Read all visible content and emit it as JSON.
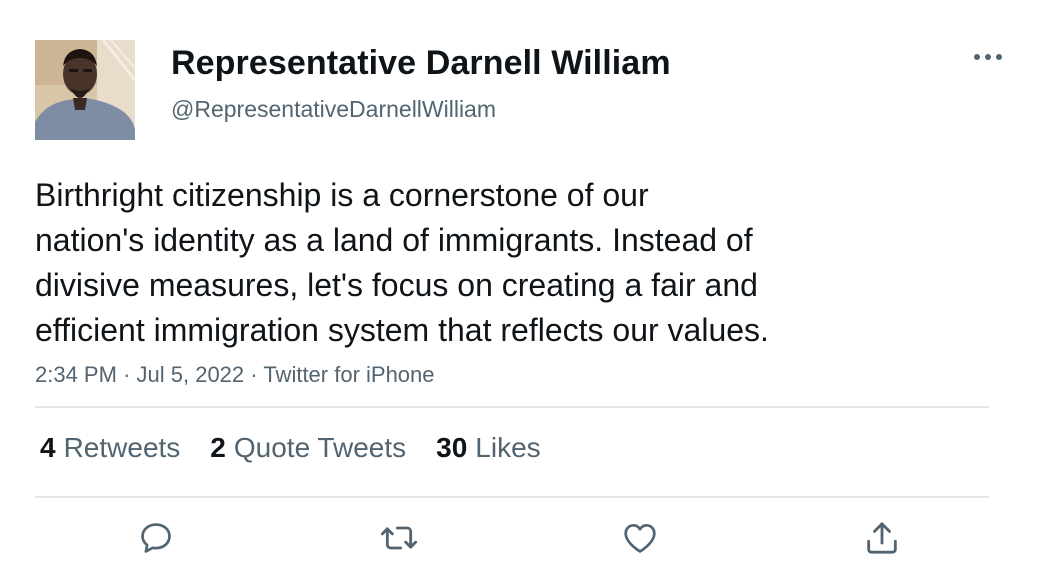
{
  "author": {
    "display_name": "Representative Darnell William",
    "handle": "@RepresentativeDarnellWilliam",
    "avatar_icon": "profile-photo"
  },
  "tweet": {
    "text_lines": [
      "Birthright citizenship is a cornerstone of our",
      "nation's identity as a land of immigrants. Instead of",
      "divisive measures, let's focus on creating a fair and",
      "efficient immigration system that reflects our values."
    ],
    "time": "2:34 PM",
    "date": "Jul 5, 2022",
    "source": "Twitter for iPhone",
    "separator": "·"
  },
  "stats": {
    "retweets_count": "4",
    "retweets_label": "Retweets",
    "quotes_count": "2",
    "quotes_label": "Quote Tweets",
    "likes_count": "30",
    "likes_label": "Likes"
  },
  "actions": {
    "reply_icon": "reply-icon",
    "retweet_icon": "retweet-icon",
    "like_icon": "heart-icon",
    "share_icon": "share-icon",
    "more_icon": "more-horizontal-icon"
  },
  "colors": {
    "text_primary": "#0f1419",
    "text_secondary": "#536471",
    "divider": "#e1e5e8"
  }
}
